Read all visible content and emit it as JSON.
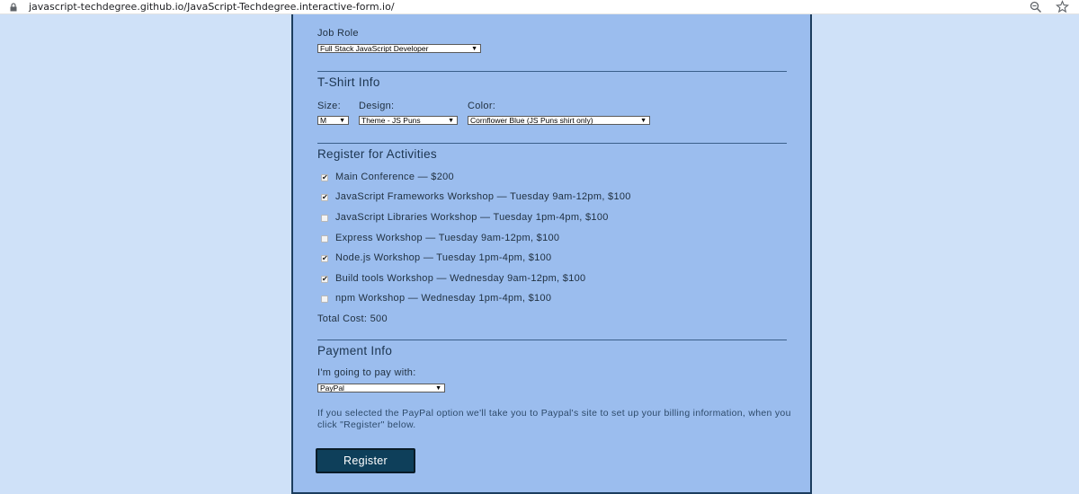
{
  "browser": {
    "url": "javascript-techdegree.github.io/JavaScript-Techdegree.interactive-form.io/",
    "icons": [
      "lock-icon",
      "zoom-icon",
      "star-icon"
    ]
  },
  "form": {
    "job_role": {
      "label": "Job Role",
      "selected": "Full Stack JavaScript Developer"
    },
    "tshirt": {
      "heading": "T-Shirt Info",
      "size": {
        "label": "Size:",
        "selected": "M"
      },
      "design": {
        "label": "Design:",
        "selected": "Theme - JS Puns"
      },
      "color": {
        "label": "Color:",
        "selected": "Cornflower Blue (JS Puns shirt only)"
      }
    },
    "activities": {
      "heading": "Register for Activities",
      "items": [
        {
          "label": "Main Conference — $200",
          "checked": true
        },
        {
          "label": "JavaScript Frameworks Workshop — Tuesday 9am-12pm, $100",
          "checked": true
        },
        {
          "label": "JavaScript Libraries Workshop — Tuesday 1pm-4pm, $100",
          "checked": false
        },
        {
          "label": "Express Workshop — Tuesday 9am-12pm, $100",
          "checked": false
        },
        {
          "label": "Node.js Workshop — Tuesday 1pm-4pm, $100",
          "checked": true
        },
        {
          "label": "Build tools Workshop — Wednesday 9am-12pm, $100",
          "checked": true
        },
        {
          "label": "npm Workshop — Wednesday 1pm-4pm, $100",
          "checked": false
        }
      ],
      "total": "Total Cost: 500"
    },
    "payment": {
      "heading": "Payment Info",
      "pay_label": "I'm going to pay with:",
      "selected": "PayPal",
      "note": "If you selected the PayPal option we'll take you to Paypal's site to set up your billing information, when you click \"Register\" below."
    },
    "register_label": "Register"
  },
  "colors": {
    "page_bg": "#cfe1f8",
    "panel_bg": "#9bbdee",
    "panel_border": "#1c3d5e",
    "button_bg": "#0e3f5a"
  }
}
